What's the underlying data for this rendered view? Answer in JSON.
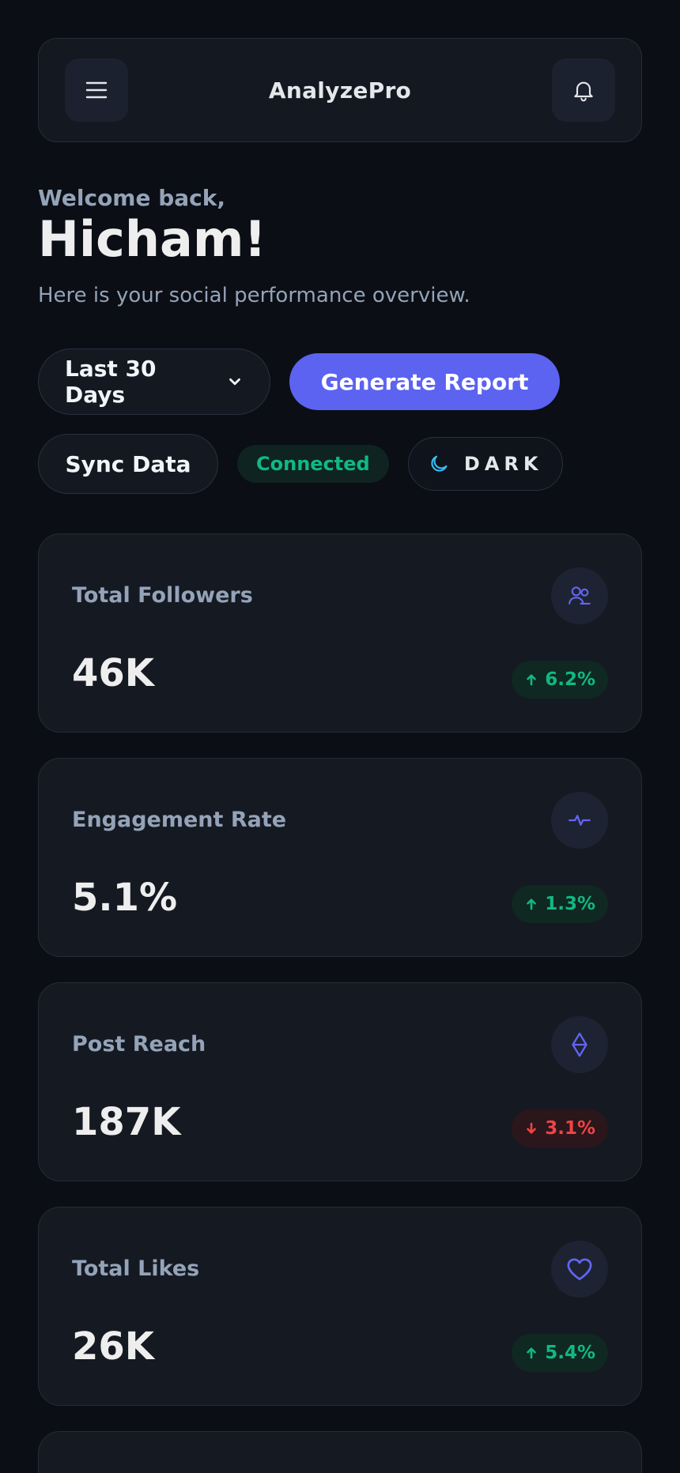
{
  "header": {
    "title": "AnalyzePro",
    "menu_icon": "menu-icon",
    "bell_icon": "bell-icon"
  },
  "welcome": {
    "greeting": "Welcome back,",
    "name": "Hicham!",
    "subtitle": "Here is your social performance overview."
  },
  "controls": {
    "date_range": "Last 30 Days",
    "generate_label": "Generate Report",
    "sync_label": "Sync Data",
    "status_label": "Connected",
    "theme_label": "DARK"
  },
  "stats": [
    {
      "label": "Total Followers",
      "value": "46K",
      "trend": "6.2%",
      "direction": "up",
      "icon": "users-icon"
    },
    {
      "label": "Engagement Rate",
      "value": "5.1%",
      "trend": "1.3%",
      "direction": "up",
      "icon": "activity-icon"
    },
    {
      "label": "Post Reach",
      "value": "187K",
      "trend": "3.1%",
      "direction": "down",
      "icon": "reach-icon"
    },
    {
      "label": "Total Likes",
      "value": "26K",
      "trend": "5.4%",
      "direction": "up",
      "icon": "heart-icon"
    }
  ],
  "colors": {
    "background": "#0b0e15",
    "card": "#151922",
    "accent": "#5b63f0",
    "positive": "#10b981",
    "negative": "#ef4444",
    "muted": "#94a3b8"
  }
}
